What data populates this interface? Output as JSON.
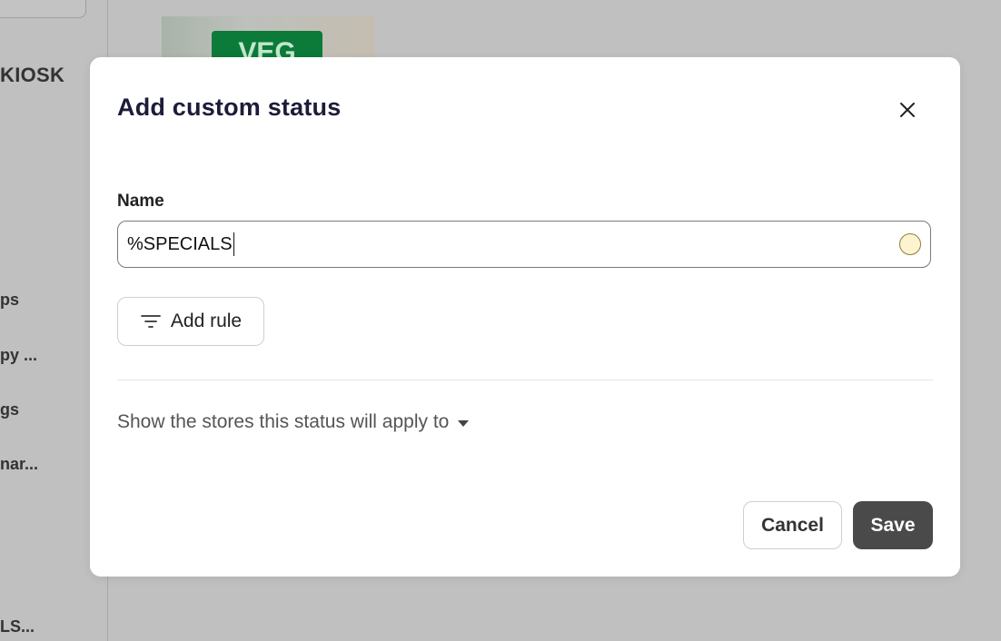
{
  "background": {
    "brand": "KIOSK",
    "nav_items": [
      "ps",
      "py ...",
      "gs",
      "nar...",
      "LS..."
    ],
    "tile_badge": "VEG"
  },
  "modal": {
    "title": "Add custom status",
    "close_icon": "close-icon",
    "name_label": "Name",
    "name_value": "%SPECIALS",
    "status_color": "#fdf4cf",
    "add_rule_label": "Add rule",
    "add_rule_icon": "filter-icon",
    "show_stores_label": "Show the stores this status will apply to",
    "cancel_label": "Cancel",
    "save_label": "Save"
  }
}
